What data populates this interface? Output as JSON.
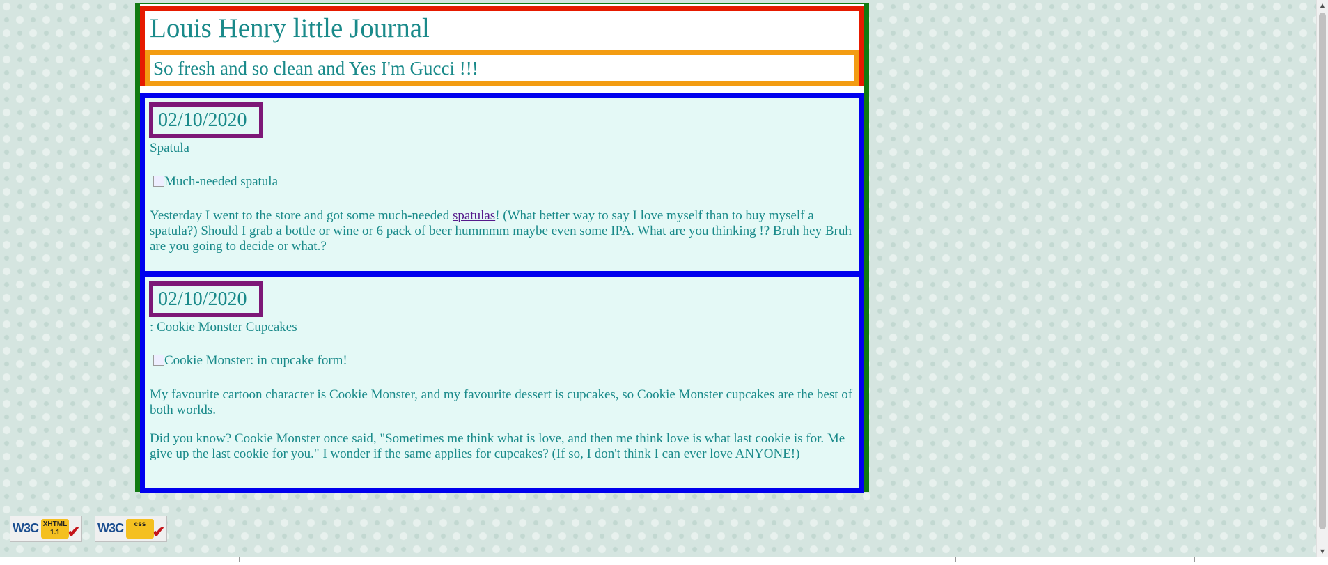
{
  "header": {
    "title": "Louis Henry little Journal",
    "tagline": "So fresh and so clean and Yes I'm Gucci !!!"
  },
  "posts": [
    {
      "date": "02/10/2020",
      "title": "Spatula",
      "image_alt": "Much-needed spatula",
      "para_before_link": "Yesterday I went to the store and got some much-needed ",
      "link_text": "spatulas",
      "para_after_link": "! (What better way to say I love myself than to buy myself a spatula?) Should I grab a bottle or wine or 6 pack of beer hummmm maybe even some IPA. What are you thinking !? Bruh hey Bruh are you going to decide or what.?"
    },
    {
      "date": "02/10/2020",
      "title": ": Cookie Monster Cupcakes",
      "image_alt": "Cookie Monster: in cupcake form!",
      "paragraph1": "My favourite cartoon character is Cookie Monster, and my favourite dessert is cupcakes, so Cookie Monster cupcakes are the best of both worlds.",
      "paragraph2": "Did you know? Cookie Monster once said, \"Sometimes me think what is love, and then me think love is what last cookie is for. Me give up the last cookie for you.\" I wonder if the same applies for cupcakes? (If so, I don't think I can ever love ANYONE!)"
    }
  ],
  "badges": {
    "xhtml": {
      "w3c": "W3C",
      "label": "XHTML\n1.1"
    },
    "css": {
      "w3c": "W3C",
      "label": "css"
    }
  },
  "colors": {
    "text": "#1a8a8a",
    "container_border": "#117a11",
    "header_border": "#e61a00",
    "tagline_border": "#f39c12",
    "post_border": "#0000ee",
    "date_border": "#7d1877",
    "post_background": "#e4f9f6",
    "link": "#551a8b"
  }
}
